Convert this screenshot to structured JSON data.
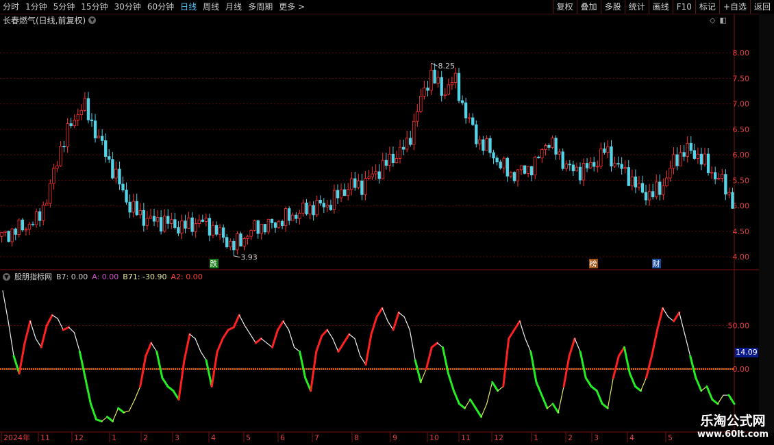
{
  "toolbar": {
    "periods": [
      "分时",
      "1分钟",
      "5分钟",
      "15分钟",
      "30分钟",
      "60分钟",
      "日线",
      "周线",
      "月线",
      "多周期",
      "更多 >"
    ],
    "active_index": 6,
    "buttons": [
      "复权",
      "叠加",
      "多股",
      "统计",
      "画线",
      "F10",
      "标记",
      "+自选",
      "返回"
    ]
  },
  "main_title": "长春燃气(日线,前复权)",
  "indicator_header": {
    "name": "股朋指标网",
    "items": [
      {
        "label": "B7: 0.00",
        "color": "#d0d0d0"
      },
      {
        "label": "A: 0.00",
        "color": "#d050d0"
      },
      {
        "label": "B71: -30.90",
        "color": "#e8e8a0"
      },
      {
        "label": "A2: 0.00",
        "color": "#ff4040"
      }
    ]
  },
  "current_value_tag": "14.09",
  "watermark": {
    "line1": "乐淘公式网",
    "line2": "www.60lt.com"
  },
  "chart_data": [
    {
      "type": "candlestick",
      "title": "长春燃气(日线,前复权)",
      "y_ticks": [
        "8.00",
        "7.50",
        "7.00",
        "6.50",
        "6.00",
        "5.50",
        "5.00",
        "4.50",
        "4.00"
      ],
      "ylim": [
        3.8,
        8.5
      ],
      "annotations": [
        {
          "label": "8.25",
          "kind": "high"
        },
        {
          "label": "3.93",
          "kind": "low"
        }
      ],
      "markers": [
        {
          "label": "跌",
          "color": "#1a7a1a"
        },
        {
          "label": "榜",
          "color": "#a05010"
        },
        {
          "label": "财",
          "color": "#1a4a9a"
        }
      ],
      "close_trend": [
        4.4,
        4.5,
        4.6,
        4.7,
        5.2,
        6.1,
        6.6,
        7.0,
        6.5,
        6.0,
        5.5,
        5.0,
        4.8,
        4.7,
        4.7,
        4.6,
        4.6,
        4.7,
        4.6,
        4.4,
        4.2,
        4.4,
        4.6,
        4.6,
        4.7,
        4.8,
        4.9,
        5.0,
        5.0,
        5.2,
        5.4,
        5.4,
        5.6,
        5.8,
        6.0,
        6.2,
        7.0,
        7.6,
        7.2,
        7.5,
        6.8,
        6.3,
        6.1,
        5.8,
        5.6,
        5.7,
        5.8,
        6.3,
        6.0,
        5.7,
        5.7,
        5.8,
        6.1,
        5.8,
        5.6,
        5.3,
        5.2,
        5.4,
        5.9,
        6.1,
        6.0,
        5.7,
        5.5,
        5.1
      ]
    },
    {
      "type": "line",
      "title": "股朋指标网",
      "y_ticks": [
        "50.00",
        "0.00"
      ],
      "ylim": [
        -70,
        100
      ],
      "values": [
        90,
        55,
        15,
        -5,
        30,
        55,
        35,
        25,
        50,
        62,
        58,
        45,
        48,
        42,
        20,
        -10,
        -40,
        -58,
        -60,
        -55,
        -60,
        -45,
        -50,
        -48,
        -35,
        -20,
        15,
        30,
        20,
        -10,
        -20,
        -25,
        -35,
        10,
        40,
        35,
        20,
        10,
        -20,
        20,
        35,
        45,
        48,
        62,
        50,
        40,
        30,
        35,
        30,
        25,
        45,
        55,
        45,
        25,
        20,
        -10,
        -25,
        20,
        38,
        45,
        35,
        20,
        30,
        40,
        35,
        15,
        5,
        40,
        60,
        70,
        55,
        45,
        65,
        60,
        45,
        10,
        -15,
        0,
        25,
        30,
        25,
        -5,
        -25,
        -40,
        -45,
        -35,
        -45,
        -55,
        -40,
        -15,
        -25,
        -20,
        35,
        45,
        55,
        35,
        20,
        -15,
        -30,
        -45,
        -40,
        -50,
        -20,
        15,
        35,
        20,
        -10,
        -20,
        -25,
        -40,
        -45,
        -10,
        15,
        25,
        -5,
        -20,
        -25,
        -10,
        15,
        45,
        70,
        60,
        55,
        65,
        40,
        15,
        -10,
        -25,
        -20,
        -35,
        -40,
        -30,
        -30,
        -40
      ]
    }
  ],
  "x_labels": [
    "2024年",
    "11",
    "12",
    "1",
    "2",
    "3",
    "4",
    "5",
    "6",
    "7",
    "8",
    "9",
    "10",
    "11",
    "12",
    "1",
    "2",
    "3",
    "4",
    "5"
  ]
}
